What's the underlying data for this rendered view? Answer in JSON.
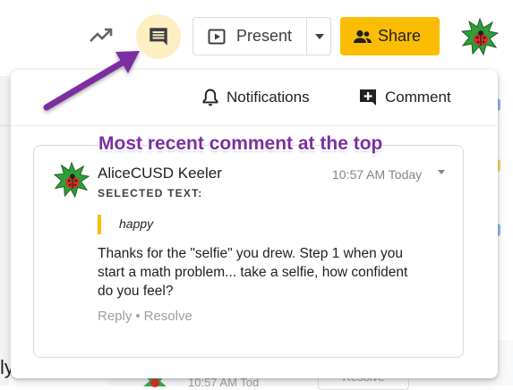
{
  "toolbar": {
    "activity_icon": "trending-up-icon",
    "comments_icon": "comment-icon",
    "present_label": "Present",
    "present_icon": "present-play-icon",
    "share_label": "Share",
    "share_icon": "people-icon"
  },
  "popup": {
    "notifications_label": "Notifications",
    "comment_label": "Comment"
  },
  "comment": {
    "author": "AliceCUSD Keeler",
    "time": "10:57 AM Today",
    "selected_label": "SELECTED TEXT:",
    "quote": "happy",
    "body": "Thanks for the \"selfie\" you drew. Step 1 when you start a math problem... take a selfie, how confident do you feel?",
    "reply_label": "Reply",
    "resolve_label": "Resolve",
    "separator": "•"
  },
  "annotation": {
    "text": "Most recent comment at the top"
  },
  "background": {
    "left_fragment": "ly",
    "ghost_time": "10:57 AM Tod",
    "ghost_button": "Resolve"
  },
  "colors": {
    "share": "#fbbc04",
    "highlight": "#feefc3",
    "annotation": "#7b2fa0"
  }
}
